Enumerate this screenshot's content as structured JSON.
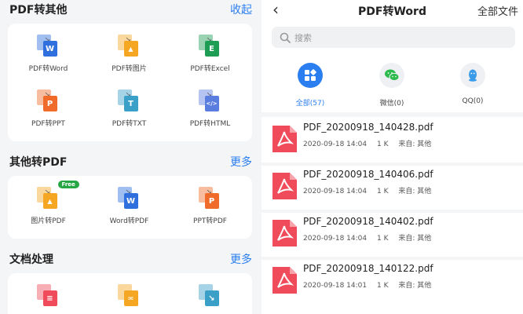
{
  "left": {
    "convert_other": {
      "title": "PDF转其他",
      "link": "收起",
      "tools": [
        {
          "label": "PDF转Word",
          "letter": "W",
          "color": "#2f6fde",
          "back": "#2f6fde"
        },
        {
          "label": "PDF转图片",
          "letter": "▲",
          "color": "#f5a623",
          "back": "#f5a623"
        },
        {
          "label": "PDF转Excel",
          "letter": "E",
          "color": "#1e9e55",
          "back": "#1e9e55"
        },
        {
          "label": "PDF转PPT",
          "letter": "P",
          "color": "#f06a2a",
          "back": "#f06a2a"
        },
        {
          "label": "PDF转TXT",
          "letter": "T",
          "color": "#3aa0c8",
          "back": "#3aa0c8"
        },
        {
          "label": "PDF转HTML",
          "letter": "</>",
          "color": "#5a7de0",
          "back": "#5a7de0"
        }
      ]
    },
    "other_to_pdf": {
      "title": "其他转PDF",
      "link": "更多",
      "badge": "Free",
      "tools": [
        {
          "label": "图片转PDF",
          "letter": "▲",
          "color": "#f5a623",
          "back": "#f5a623"
        },
        {
          "label": "Word转PDF",
          "letter": "W",
          "color": "#2f6fde",
          "back": "#2f6fde"
        },
        {
          "label": "PPT转PDF",
          "letter": "P",
          "color": "#f06a2a",
          "back": "#f06a2a"
        }
      ]
    },
    "doc_process": {
      "title": "文档处理",
      "link": "更多",
      "tools": [
        {
          "letter": "≡",
          "color": "#ef4b5a",
          "back": "#ef4b5a"
        },
        {
          "letter": "✉",
          "color": "#f5a623",
          "back": "#f5a623"
        },
        {
          "letter": "↘",
          "color": "#3aa0c8",
          "back": "#3aa0c8"
        }
      ]
    }
  },
  "right": {
    "back": "‹",
    "title": "PDF转Word",
    "all_files": "全部文件",
    "search_placeholder": "搜索",
    "filters": [
      {
        "label": "全部(57)",
        "active": true
      },
      {
        "label": "微信(0)",
        "active": false
      },
      {
        "label": "QQ(0)",
        "active": false
      }
    ],
    "files": [
      {
        "name": "PDF_20200918_140428.pdf",
        "datetime": "2020-09-18 14:04",
        "size": "1 K",
        "source": "来自: 其他"
      },
      {
        "name": "PDF_20200918_140406.pdf",
        "datetime": "2020-09-18 14:04",
        "size": "1 K",
        "source": "来自: 其他"
      },
      {
        "name": "PDF_20200918_140402.pdf",
        "datetime": "2020-09-18 14:04",
        "size": "1 K",
        "source": "来自: 其他"
      },
      {
        "name": "PDF_20200918_140122.pdf",
        "datetime": "2020-09-18 14:01",
        "size": "1 K",
        "source": "来自: 其他"
      }
    ],
    "colors": {
      "accent": "#2a7ef0",
      "pdf_red": "#ef4b5a",
      "wechat": "#2dbb4e",
      "qq": "#3a9be8"
    }
  }
}
